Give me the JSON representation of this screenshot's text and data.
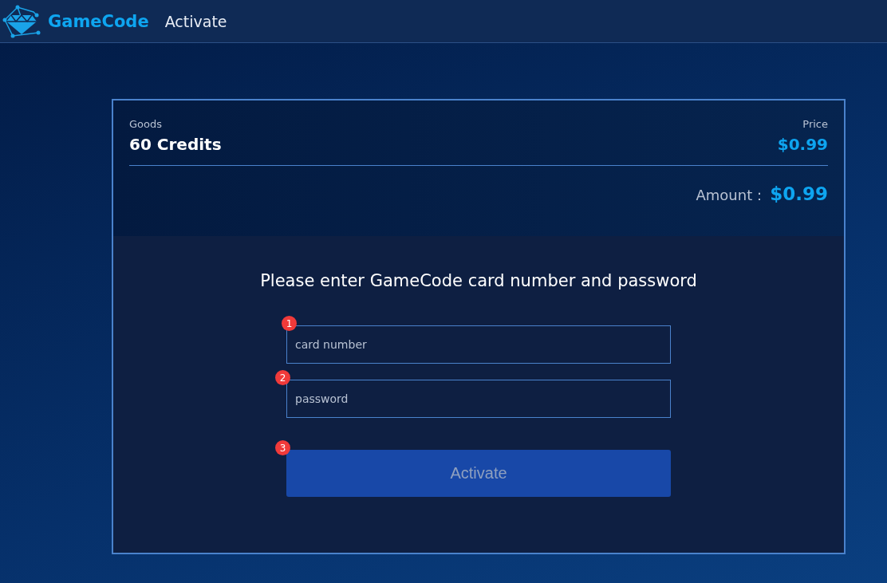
{
  "header": {
    "brand": "GameCode",
    "page_title": "Activate"
  },
  "order": {
    "goods_label": "Goods",
    "goods": "60 Credits",
    "price_label": "Price",
    "price": "$0.99",
    "amount_label": "Amount：",
    "amount": "$0.99"
  },
  "form": {
    "heading": "Please enter GameCode card number and password",
    "fields": [
      {
        "step": "1",
        "placeholder": "card number"
      },
      {
        "step": "2",
        "placeholder": "password"
      }
    ],
    "button": {
      "step": "3",
      "label": "Activate",
      "disabled": true
    }
  }
}
